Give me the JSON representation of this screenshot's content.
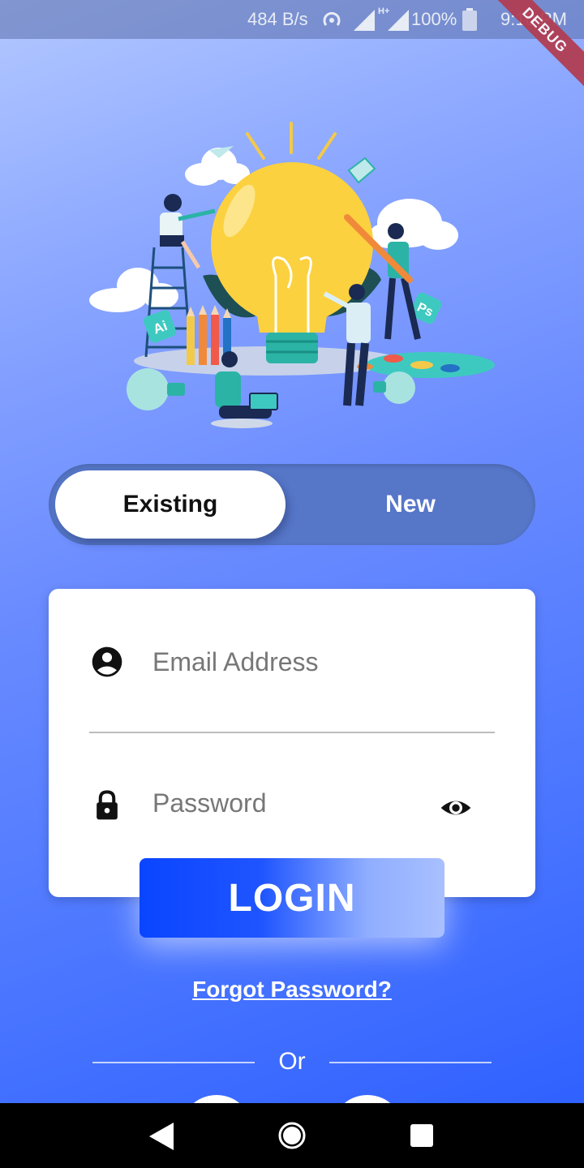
{
  "status_bar": {
    "network_speed": "484 B/s",
    "network_type": "H+",
    "battery": "100%",
    "time": "9:10 PM",
    "debug_label": "DEBUG"
  },
  "illustration": {
    "badge_ai": "Ai",
    "badge_ps": "Ps"
  },
  "toggle": {
    "existing_label": "Existing",
    "new_label": "New"
  },
  "login_form": {
    "email_placeholder": "Email Address",
    "email_value": "",
    "password_placeholder": "Password",
    "password_value": "",
    "login_label": "LOGIN",
    "forgot_label": "Forgot Password?",
    "divider_label": "Or"
  },
  "colors": {
    "accent": "#1f55ff",
    "toggle_track": "#5676c8"
  },
  "icons": {
    "email": "account-circle-icon",
    "password": "lock-icon",
    "visibility": "eye-icon",
    "nav_back": "back-triangle-icon",
    "nav_home": "home-circle-icon",
    "nav_recents": "recents-square-icon"
  }
}
